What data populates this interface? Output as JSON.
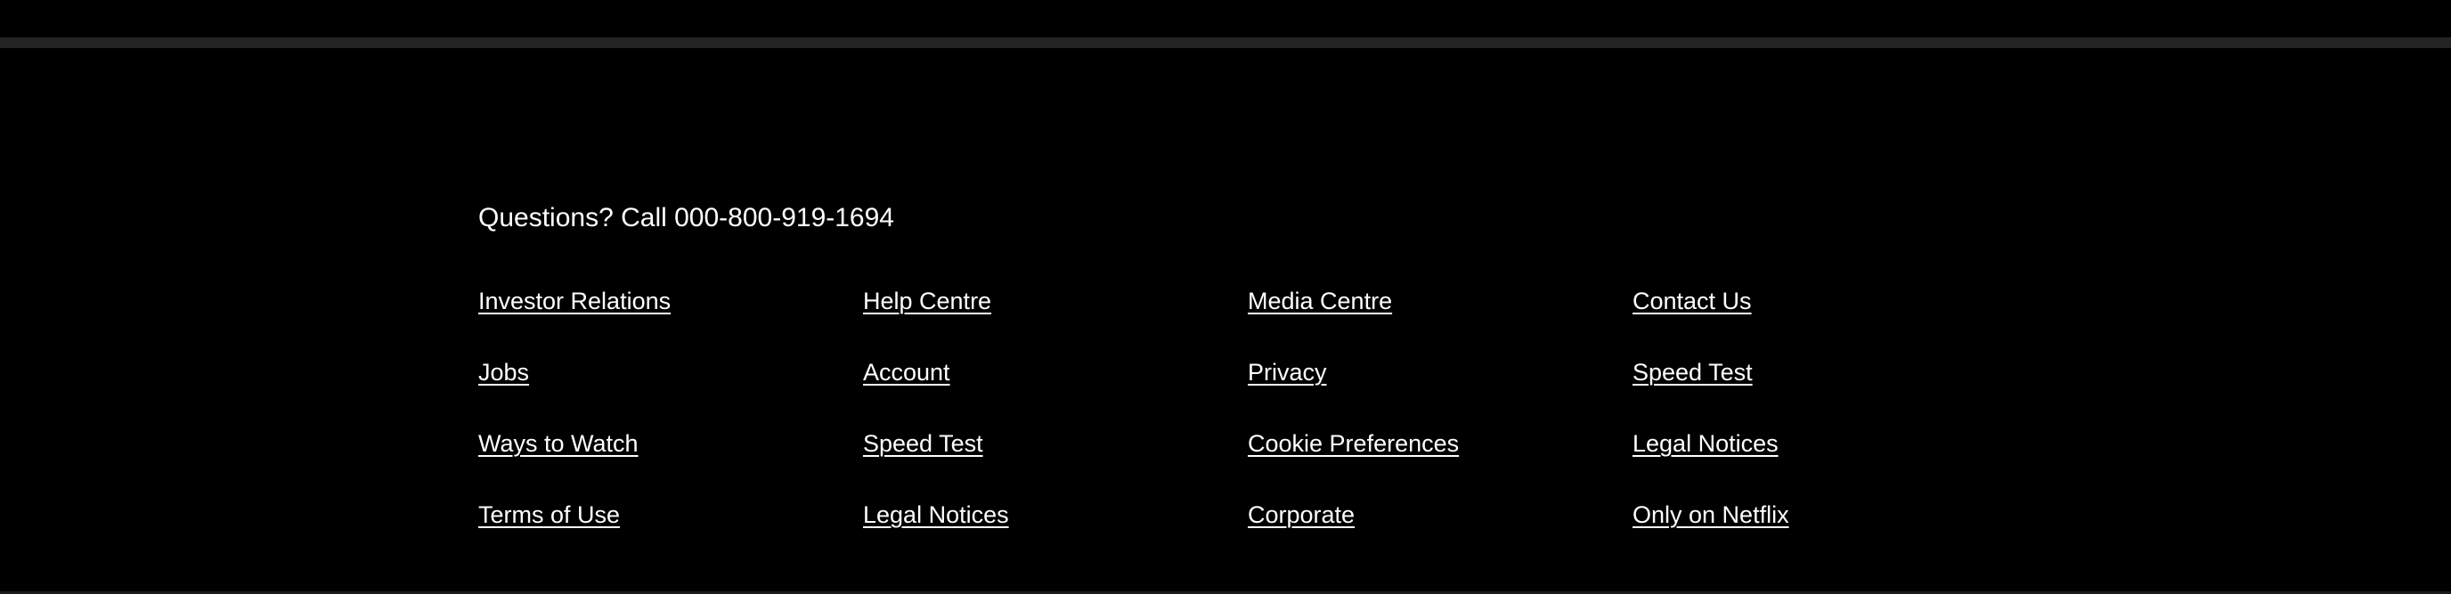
{
  "footer": {
    "questions": "Questions? Call 000-800-919-1694",
    "columns": [
      [
        "Investor Relations",
        "Jobs",
        "Ways to Watch",
        "Terms of Use"
      ],
      [
        "Help Centre",
        "Account",
        "Speed Test",
        "Legal Notices"
      ],
      [
        "Media Centre",
        "Privacy",
        "Cookie Preferences",
        "Corporate"
      ],
      [
        "Contact Us",
        "Speed Test",
        "Legal Notices",
        "Only on Netflix"
      ]
    ]
  },
  "colors": {
    "background": "#000000",
    "divider": "#232323",
    "text": "#ffffff"
  }
}
